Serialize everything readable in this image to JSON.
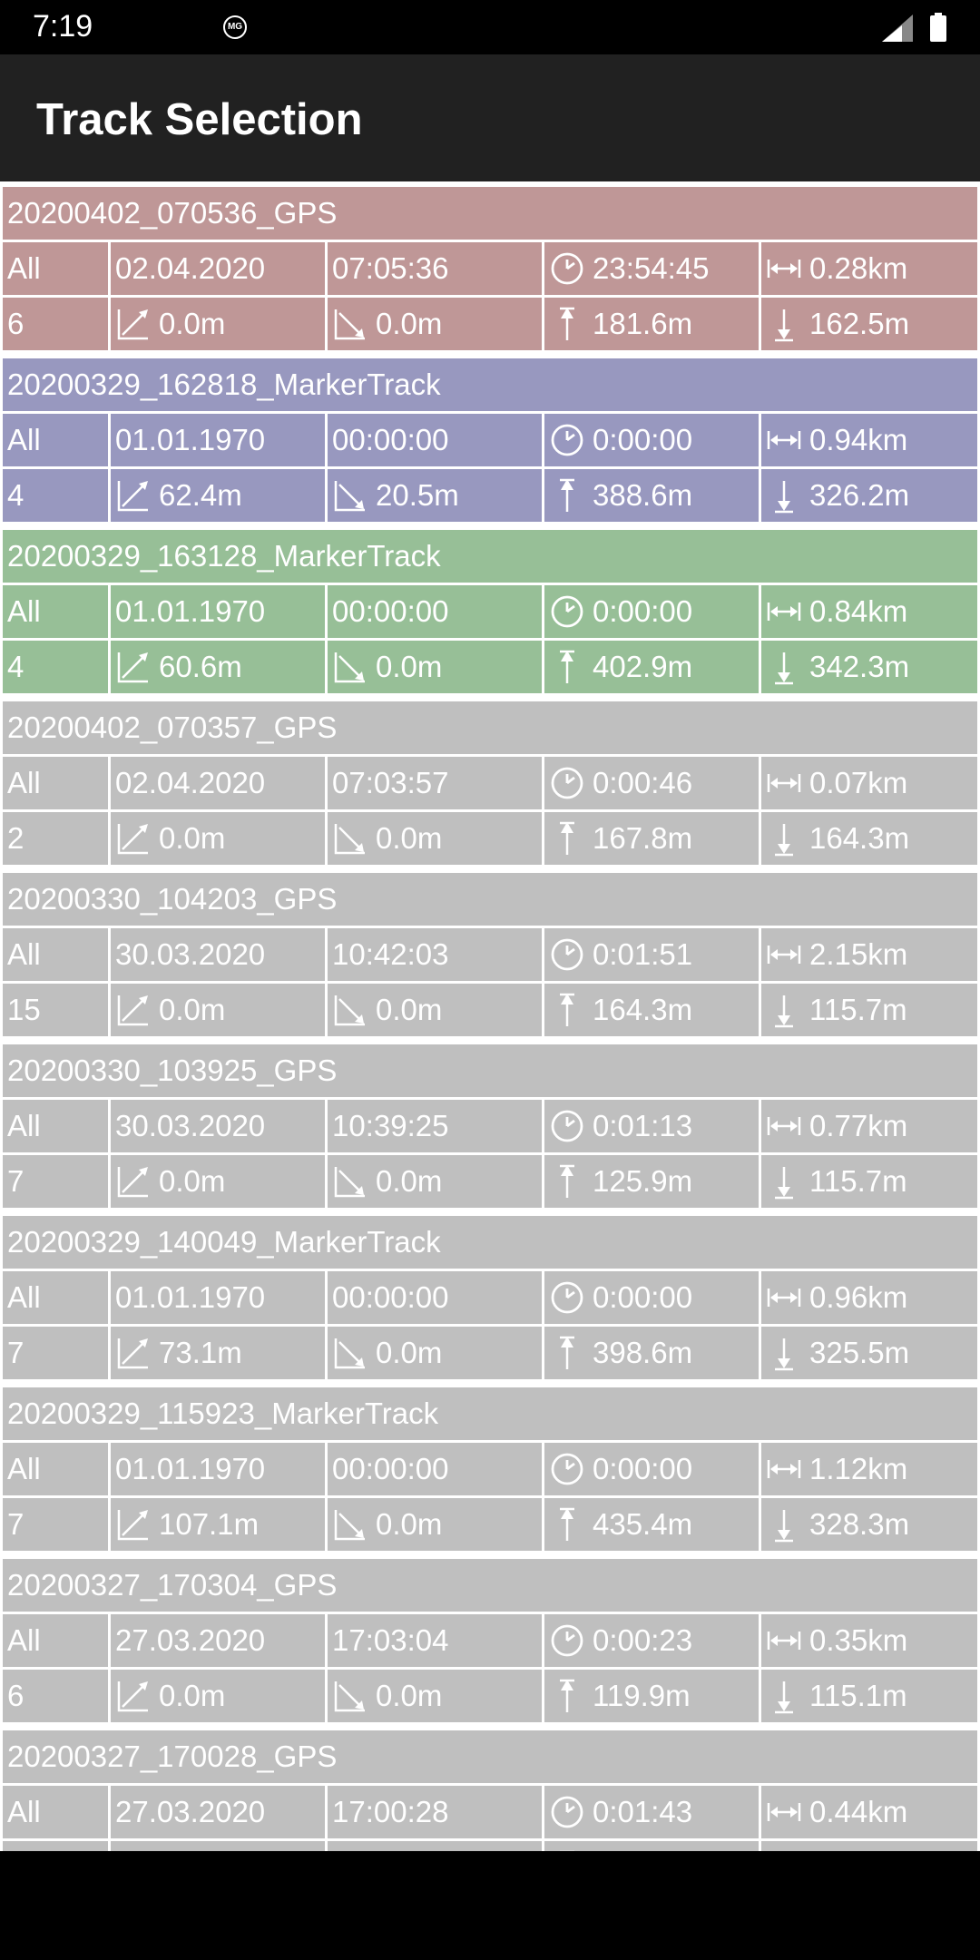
{
  "status": {
    "time": "7:19",
    "notification_badge": "MG"
  },
  "app_bar": {
    "title": "Track Selection"
  },
  "colors": {
    "red": "#bf9797",
    "blue": "#9898bf",
    "green": "#97bf97",
    "grey": "#bfbfbf"
  },
  "tracks": [
    {
      "name": "20200402_070536_GPS",
      "color": "#bf9797",
      "mode": "All",
      "date": "02.04.2020",
      "time": "07:05:36",
      "duration": "23:54:45",
      "distance": "0.28km",
      "count": "6",
      "ascent": "0.0m",
      "descent": "0.0m",
      "max_alt": "181.6m",
      "min_alt": "162.5m"
    },
    {
      "name": "20200329_162818_MarkerTrack",
      "color": "#9898bf",
      "mode": "All",
      "date": "01.01.1970",
      "time": "00:00:00",
      "duration": "0:00:00",
      "distance": "0.94km",
      "count": "4",
      "ascent": "62.4m",
      "descent": "20.5m",
      "max_alt": "388.6m",
      "min_alt": "326.2m"
    },
    {
      "name": "20200329_163128_MarkerTrack",
      "color": "#97bf97",
      "mode": "All",
      "date": "01.01.1970",
      "time": "00:00:00",
      "duration": "0:00:00",
      "distance": "0.84km",
      "count": "4",
      "ascent": "60.6m",
      "descent": "0.0m",
      "max_alt": "402.9m",
      "min_alt": "342.3m"
    },
    {
      "name": "20200402_070357_GPS",
      "color": "#bfbfbf",
      "mode": "All",
      "date": "02.04.2020",
      "time": "07:03:57",
      "duration": "0:00:46",
      "distance": "0.07km",
      "count": "2",
      "ascent": "0.0m",
      "descent": "0.0m",
      "max_alt": "167.8m",
      "min_alt": "164.3m"
    },
    {
      "name": "20200330_104203_GPS",
      "color": "#bfbfbf",
      "mode": "All",
      "date": "30.03.2020",
      "time": "10:42:03",
      "duration": "0:01:51",
      "distance": "2.15km",
      "count": "15",
      "ascent": "0.0m",
      "descent": "0.0m",
      "max_alt": "164.3m",
      "min_alt": "115.7m"
    },
    {
      "name": "20200330_103925_GPS",
      "color": "#bfbfbf",
      "mode": "All",
      "date": "30.03.2020",
      "time": "10:39:25",
      "duration": "0:01:13",
      "distance": "0.77km",
      "count": "7",
      "ascent": "0.0m",
      "descent": "0.0m",
      "max_alt": "125.9m",
      "min_alt": "115.7m"
    },
    {
      "name": "20200329_140049_MarkerTrack",
      "color": "#bfbfbf",
      "mode": "All",
      "date": "01.01.1970",
      "time": "00:00:00",
      "duration": "0:00:00",
      "distance": "0.96km",
      "count": "7",
      "ascent": "73.1m",
      "descent": "0.0m",
      "max_alt": "398.6m",
      "min_alt": "325.5m"
    },
    {
      "name": "20200329_115923_MarkerTrack",
      "color": "#bfbfbf",
      "mode": "All",
      "date": "01.01.1970",
      "time": "00:00:00",
      "duration": "0:00:00",
      "distance": "1.12km",
      "count": "7",
      "ascent": "107.1m",
      "descent": "0.0m",
      "max_alt": "435.4m",
      "min_alt": "328.3m"
    },
    {
      "name": "20200327_170304_GPS",
      "color": "#bfbfbf",
      "mode": "All",
      "date": "27.03.2020",
      "time": "17:03:04",
      "duration": "0:00:23",
      "distance": "0.35km",
      "count": "6",
      "ascent": "0.0m",
      "descent": "0.0m",
      "max_alt": "119.9m",
      "min_alt": "115.1m"
    },
    {
      "name": "20200327_170028_GPS",
      "color": "#bfbfbf",
      "mode": "All",
      "date": "27.03.2020",
      "time": "17:00:28",
      "duration": "0:01:43",
      "distance": "0.44km",
      "count": "",
      "ascent": "",
      "descent": "",
      "max_alt": "",
      "min_alt": ""
    }
  ]
}
